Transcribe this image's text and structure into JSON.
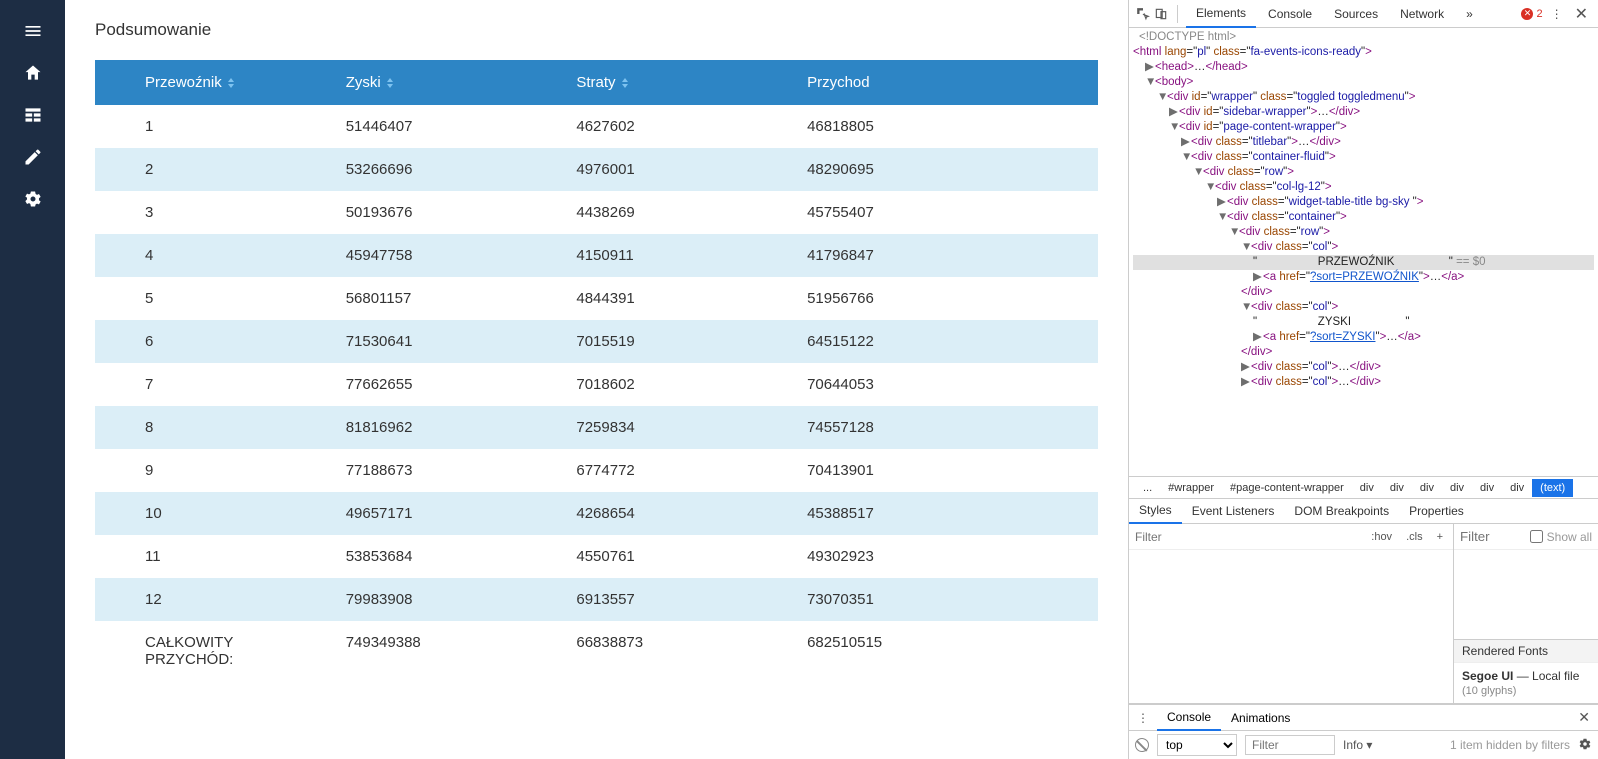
{
  "page": {
    "title": "Podsumowanie"
  },
  "table": {
    "headers": {
      "c1": "Przewoźnik",
      "c2": "Zyski",
      "c3": "Straty",
      "c4": "Przychod"
    },
    "rows": [
      {
        "c1": "1",
        "c2": "51446407",
        "c3": "4627602",
        "c4": "46818805"
      },
      {
        "c1": "2",
        "c2": "53266696",
        "c3": "4976001",
        "c4": "48290695"
      },
      {
        "c1": "3",
        "c2": "50193676",
        "c3": "4438269",
        "c4": "45755407"
      },
      {
        "c1": "4",
        "c2": "45947758",
        "c3": "4150911",
        "c4": "41796847"
      },
      {
        "c1": "5",
        "c2": "56801157",
        "c3": "4844391",
        "c4": "51956766"
      },
      {
        "c1": "6",
        "c2": "71530641",
        "c3": "7015519",
        "c4": "64515122"
      },
      {
        "c1": "7",
        "c2": "77662655",
        "c3": "7018602",
        "c4": "70644053"
      },
      {
        "c1": "8",
        "c2": "81816962",
        "c3": "7259834",
        "c4": "74557128"
      },
      {
        "c1": "9",
        "c2": "77188673",
        "c3": "6774772",
        "c4": "70413901"
      },
      {
        "c1": "10",
        "c2": "49657171",
        "c3": "4268654",
        "c4": "45388517"
      },
      {
        "c1": "11",
        "c2": "53853684",
        "c3": "4550761",
        "c4": "49302923"
      },
      {
        "c1": "12",
        "c2": "79983908",
        "c3": "6913557",
        "c4": "73070351"
      }
    ],
    "total": {
      "c1": "CAŁKOWITY PRZYCHÓD:",
      "c2": "749349388",
      "c3": "66838873",
      "c4": "682510515"
    }
  },
  "devtools": {
    "tabs": {
      "elements": "Elements",
      "console": "Console",
      "sources": "Sources",
      "network": "Network",
      "more": "»"
    },
    "errors": "2",
    "crumbs": [
      "...",
      "#wrapper",
      "#page-content-wrapper",
      "div",
      "div",
      "div",
      "div",
      "div",
      "div",
      "(text)"
    ],
    "styles_tabs": {
      "styles": "Styles",
      "event": "Event Listeners",
      "dom": "DOM Breakpoints",
      "props": "Properties"
    },
    "filter_placeholder": "Filter",
    "hov": ":hov",
    "cls": ".cls",
    "showall": "Show all",
    "rendered_fonts_title": "Rendered Fonts",
    "rf_name": "Segoe UI",
    "rf_src": "Local file",
    "rf_count": "(10 glyphs)",
    "console_tabs": {
      "console": "Console",
      "animations": "Animations"
    },
    "console_top": "top",
    "console_info": "Info",
    "console_hidden": "1 item hidden by filters",
    "dom": {
      "doctype": "<!DOCTYPE html>",
      "html_lang": "pl",
      "html_class": "fa-events-icons-ready",
      "przewoznik_text": "                   PRZEWOŹNIK                 ",
      "przewoznik_eq": "== $0",
      "sort_przewoznik": "?sort=PRZEWOŹNIK",
      "zyski_text": "                   ZYSKI                 ",
      "sort_zyski": "?sort=ZYSKI"
    }
  }
}
